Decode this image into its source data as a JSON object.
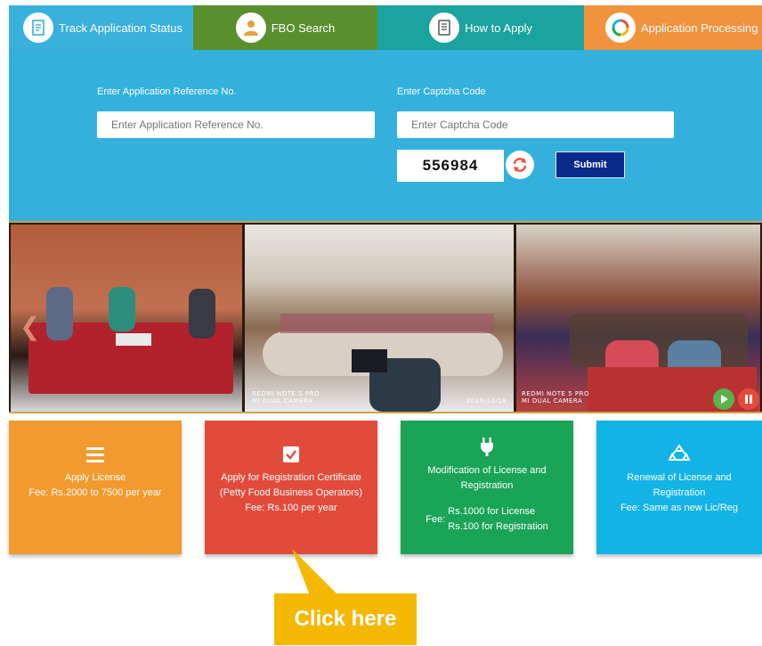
{
  "tabs": [
    {
      "label": "Track Application Status",
      "icon": "document-icon"
    },
    {
      "label": "FBO Search",
      "icon": "person-icon"
    },
    {
      "label": "How to Apply",
      "icon": "form-icon"
    },
    {
      "label": "Application Processing",
      "icon": "cycle-icon"
    }
  ],
  "form": {
    "ref_label": "Enter Application Reference No.",
    "ref_placeholder": "Enter Application Reference No.",
    "captcha_label": "Enter Captcha Code",
    "captcha_placeholder": "Enter Captcha Code",
    "captcha_value": "556984",
    "submit_label": "Submit"
  },
  "carousel": {
    "photo_tag_1": "REDMI NOTE 5 PRO\nMI DUAL CAMERA",
    "photo_date": "2019/10/18",
    "photo_tag_2": "REDMI NOTE 5 PRO\nMI DUAL CAMERA"
  },
  "tiles": [
    {
      "title": "Apply License",
      "fee": "Fee: Rs.2000 to 7500 per year",
      "icon": "menu-icon"
    },
    {
      "title": "Apply for Registration Certificate (Petty Food Business Operators)",
      "fee": "Fee: Rs.100 per year",
      "icon": "checkbox-icon"
    },
    {
      "title": "Modification of License and Registration",
      "fee_label": "Fee:",
      "fee_lines": [
        "Rs.1000 for License",
        "Rs.100 for Registration"
      ],
      "icon": "plug-icon"
    },
    {
      "title": "Renewal of License and Registration",
      "fee": "Fee: Same as new Lic/Reg",
      "icon": "recycle-icon"
    }
  ],
  "callout": {
    "label": "Click here"
  },
  "colors": {
    "panel_blue": "#33b1dc",
    "tab_green": "#5a8f2e",
    "tab_teal": "#1aa39f",
    "tab_orange": "#f1923c",
    "submit_navy": "#0a2a8c",
    "tile_orange": "#f29a2e",
    "tile_red": "#e24b3b",
    "tile_green": "#1aa457",
    "tile_blue": "#12b4e6",
    "callout_yellow": "#f5b800"
  }
}
